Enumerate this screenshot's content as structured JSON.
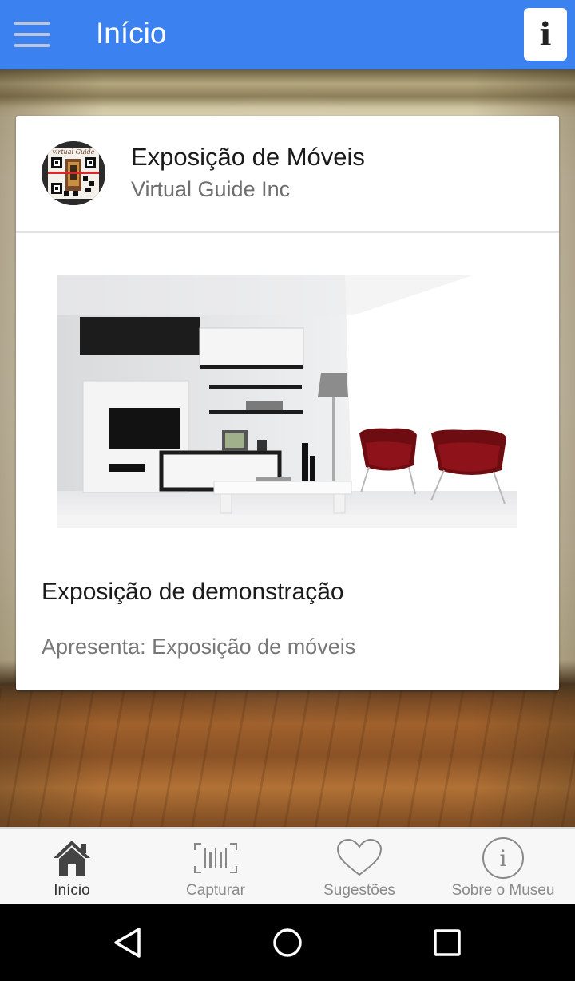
{
  "app_bar": {
    "title": "Início",
    "info_label": "i",
    "color": "#3b82f0"
  },
  "card": {
    "title": "Exposição de Móveis",
    "subtitle": "Virtual Guide Inc",
    "heading": "Exposição de demonstração",
    "description": "Apresenta: Exposição de móveis",
    "avatar_icon": "qr-code-logo-icon",
    "image_icon": "living-room-photo"
  },
  "bottom_nav": {
    "items": [
      {
        "label": "Início",
        "icon": "home-icon",
        "active": true
      },
      {
        "label": "Capturar",
        "icon": "barcode-icon",
        "active": false
      },
      {
        "label": "Sugestões",
        "icon": "heart-icon",
        "active": false
      },
      {
        "label": "Sobre o Museu",
        "icon": "info-circle-icon",
        "active": false
      }
    ]
  },
  "system_nav": {
    "back": "back-triangle-icon",
    "home": "home-circle-icon",
    "recents": "recents-square-icon"
  }
}
